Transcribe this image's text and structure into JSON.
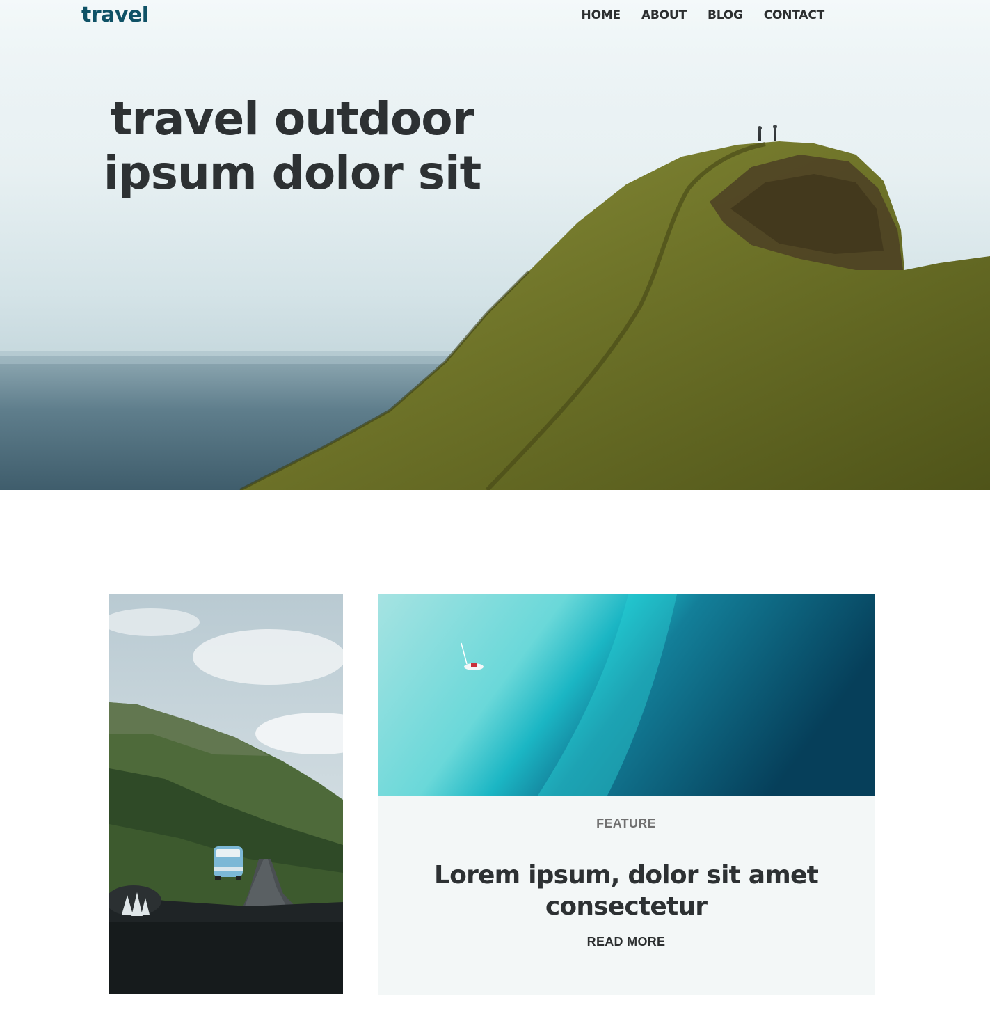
{
  "header": {
    "logo": "travel",
    "nav": [
      {
        "label": "HOME"
      },
      {
        "label": "ABOUT"
      },
      {
        "label": "BLOG"
      },
      {
        "label": "CONTACT"
      }
    ]
  },
  "hero": {
    "title_line1": "travel outdoor",
    "title_line2": "ipsum dolor sit"
  },
  "feature_card": {
    "tag": "FEATURE",
    "title_line1": "Lorem ipsum, dolor sit amet",
    "title_line2": "consectetur",
    "cta": "READ MORE"
  },
  "colors": {
    "brand": "#0f5266",
    "text": "#2c2f30",
    "muted": "#707070",
    "panel_bg": "#f3f7f7"
  }
}
